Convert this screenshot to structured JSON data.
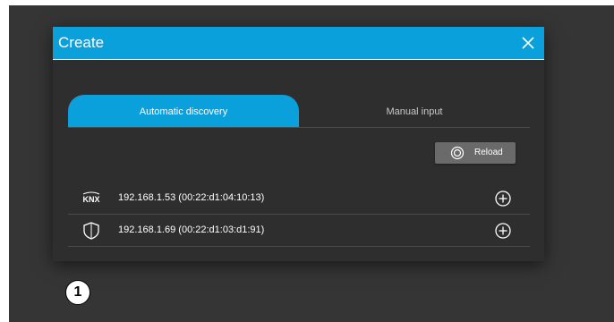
{
  "dialog": {
    "title": "Create",
    "close_icon": "close-icon"
  },
  "tabs": [
    {
      "label": "Automatic discovery",
      "active": true
    },
    {
      "label": "Manual input",
      "active": false
    }
  ],
  "reload": {
    "label": "Reload",
    "icon": "reload-icon"
  },
  "devices": [
    {
      "icon": "knx-icon",
      "label": "192.168.1.53 (00:22:d1:04:10:13)"
    },
    {
      "icon": "shield-icon",
      "label": "192.168.1.69 (00:22:d1:03:d1:91)"
    }
  ],
  "callout": {
    "label": "1"
  },
  "colors": {
    "accent": "#0aa0dc",
    "dialog_bg": "#2e2e2e",
    "backdrop": "#353535"
  }
}
